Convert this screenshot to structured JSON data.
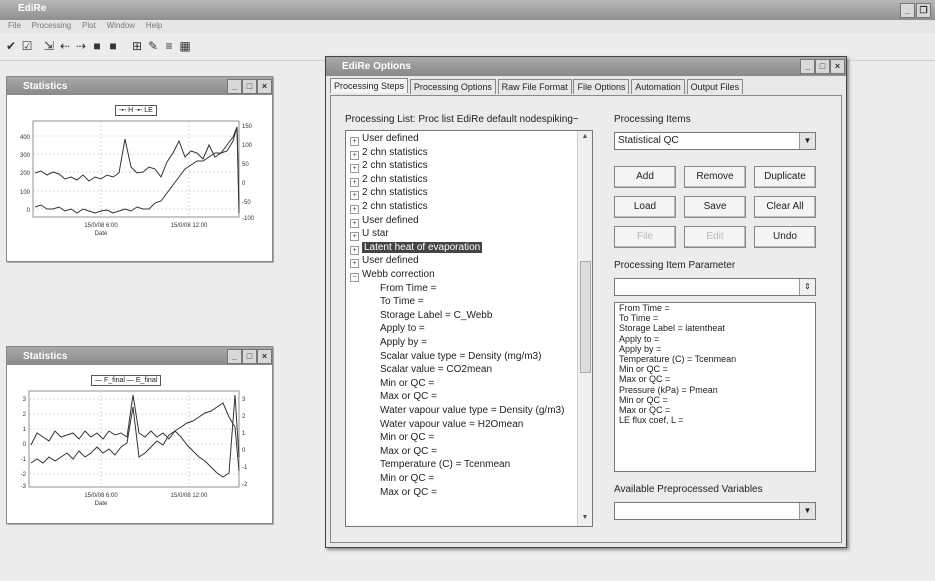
{
  "app": {
    "title": "EdiRe",
    "menu": [
      "File",
      "Processing",
      "Plot",
      "Window",
      "Help"
    ]
  },
  "stats_upper": {
    "title": "Statistics",
    "legend": [
      "H",
      "LE"
    ],
    "y_left_ticks": [
      "400",
      "300",
      "200",
      "100",
      "0"
    ],
    "y_right_ticks": [
      "150",
      "100",
      "50",
      "0",
      "-50",
      "-100"
    ],
    "x_ticks": [
      "15/0/08 6:00",
      "15/0/08 12:00"
    ],
    "xlabel": "Date"
  },
  "stats_lower": {
    "title": "Statistics",
    "legend": [
      "F_final",
      "E_final"
    ],
    "y_left_ticks": [
      "3",
      "2",
      "1",
      "0",
      "-1",
      "-2",
      "-3"
    ],
    "y_right_ticks": [
      "3",
      "2",
      "1",
      "0",
      "-1",
      "-2"
    ],
    "x_ticks": [
      "15/0/08 6:00",
      "15/0/08 12:00"
    ],
    "xlabel": "Date"
  },
  "dialog": {
    "title": "EdiRe Options",
    "tabs": [
      "Processing Steps",
      "Processing Options",
      "Raw File Format",
      "File Options",
      "Automation",
      "Output Files"
    ],
    "list_label": "Processing List: Proc list EdiRe default nodespiking~",
    "list_items": [
      {
        "text": "User defined",
        "type": "node"
      },
      {
        "text": "2 chn statistics",
        "type": "node"
      },
      {
        "text": "2 chn statistics",
        "type": "node"
      },
      {
        "text": "2 chn statistics",
        "type": "node"
      },
      {
        "text": "2 chn statistics",
        "type": "node"
      },
      {
        "text": "2 chn statistics",
        "type": "node"
      },
      {
        "text": "User defined",
        "type": "node"
      },
      {
        "text": "U star",
        "type": "node"
      },
      {
        "text": "Latent heat of evaporation",
        "type": "selected"
      },
      {
        "text": "User defined",
        "type": "node"
      },
      {
        "text": "Webb correction",
        "type": "open"
      },
      {
        "text": "From Time =",
        "type": "child"
      },
      {
        "text": "To Time =",
        "type": "child"
      },
      {
        "text": "Storage Label = C_Webb",
        "type": "child"
      },
      {
        "text": "Apply to =",
        "type": "child"
      },
      {
        "text": "Apply by =",
        "type": "child"
      },
      {
        "text": "Scalar value type = Density (mg/m3)",
        "type": "child"
      },
      {
        "text": "Scalar value = CO2mean",
        "type": "child"
      },
      {
        "text": "Min or QC =",
        "type": "child"
      },
      {
        "text": "Max or QC =",
        "type": "child"
      },
      {
        "text": "Water vapour value type = Density (g/m3)",
        "type": "child"
      },
      {
        "text": "Water vapour value = H2Omean",
        "type": "child"
      },
      {
        "text": "Min or QC =",
        "type": "child"
      },
      {
        "text": "Max or QC =",
        "type": "child"
      },
      {
        "text": "Temperature (C) = Tcenmean",
        "type": "child"
      },
      {
        "text": "Min or QC =",
        "type": "child"
      },
      {
        "text": "Max or QC =",
        "type": "child"
      }
    ],
    "processing_items_label": "Processing Items",
    "processing_item_value": "Statistical QC",
    "buttons": {
      "add": "Add",
      "remove": "Remove",
      "duplicate": "Duplicate",
      "load": "Load",
      "save": "Save",
      "clear_all": "Clear All",
      "file": "File",
      "edit": "Edit",
      "undo": "Undo"
    },
    "param_label": "Processing Item Parameter",
    "param_lines": [
      "From Time =",
      "To Time =",
      "Storage Label = latentheat",
      "Apply to =",
      "Apply by =",
      "Temperature (C) = Tcenmean",
      "Min or QC =",
      "Max or QC =",
      "Pressure (kPa) = Pmean",
      "Min or QC =",
      "Max or QC =",
      "LE flux coef, L ="
    ],
    "preprocessed_label": "Available Preprocessed Variables"
  }
}
